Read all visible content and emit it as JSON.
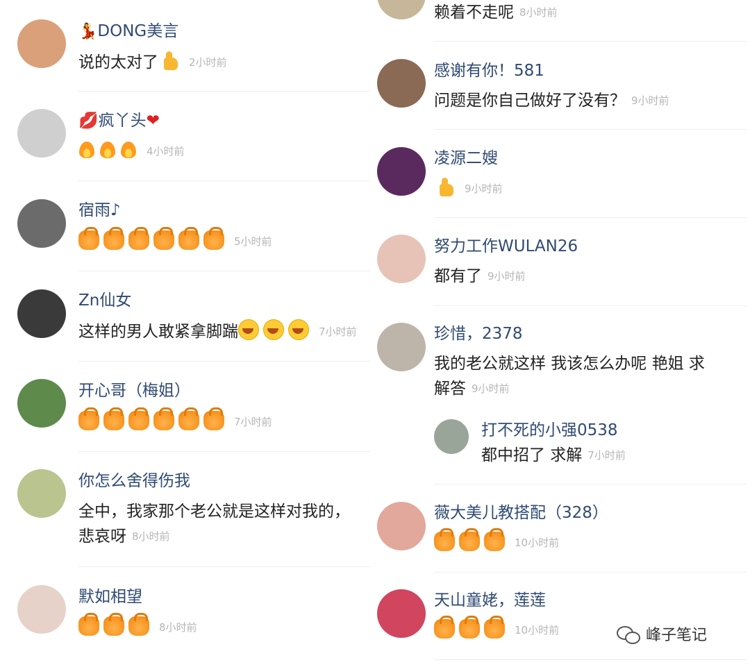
{
  "left_comments": [
    {
      "name": "DONG美言",
      "name_prefix_icon": "dancer-icon",
      "text": "说的太对了",
      "emojis": [
        "thumb"
      ],
      "time": "2小时前",
      "avatar_color": "#d9a07a"
    },
    {
      "name": "疯丫头",
      "name_prefix_icon": "lips-icon",
      "name_suffix_icon": "heart-icon",
      "text": "",
      "emojis": [
        "fire",
        "fire",
        "fire"
      ],
      "time": "4小时前",
      "avatar_color": "#9a9a9a"
    },
    {
      "name": "宿雨♪",
      "text": "",
      "emojis": [
        "bag",
        "bag",
        "bag",
        "bag",
        "bag",
        "bag"
      ],
      "time": "5小时前",
      "avatar_color": "#6b6b6b"
    },
    {
      "name": "Zn仙女",
      "text": "这样的男人敢紧拿脚踹",
      "emojis": [
        "laugh",
        "laugh",
        "laugh"
      ],
      "time": "7小时前",
      "avatar_color": "#3a3a3a"
    },
    {
      "name": "开心哥（梅姐）",
      "text": "",
      "emojis": [
        "bag",
        "bag",
        "bag",
        "bag",
        "bag",
        "bag"
      ],
      "time": "7小时前",
      "avatar_color": "#5e8a4c"
    },
    {
      "name": "你怎么舍得伤我",
      "text": "全中，我家那个老公就是这样对我的，",
      "text2": "悲哀呀",
      "emojis": [],
      "time": "8小时前",
      "avatar_color": "#b9c48f"
    },
    {
      "name": "默如相望",
      "text": "",
      "emojis": [
        "bag",
        "bag",
        "bag"
      ],
      "time": "8小时前",
      "avatar_color": "#e7d2c9"
    }
  ],
  "right_comments": [
    {
      "name": "",
      "text": "赖着不走呢",
      "emojis": [],
      "time": "8小时前",
      "avatar_color": "#c7b79a"
    },
    {
      "name": "感谢有你！581",
      "text": "问题是你自己做好了没有？",
      "emojis": [],
      "time": "9小时前",
      "avatar_color": "#8a6a55"
    },
    {
      "name": "凌源二嫂",
      "text": "",
      "emojis": [
        "thumb"
      ],
      "time": "9小时前",
      "avatar_color": "#5a2a5f"
    },
    {
      "name": "努力工作WULAN26",
      "text": "都有了",
      "emojis": [],
      "time": "9小时前",
      "avatar_color": "#e6c3b6"
    },
    {
      "name": "珍惜，2378",
      "text": "我的老公就这样 我该怎么办呢 艳姐 求",
      "text2": "解答",
      "emojis": [],
      "time": "9小时前",
      "avatar_color": "#bdb5aa"
    },
    {
      "name": "打不死的小强0538",
      "text": "都中招了 求解",
      "emojis": [],
      "time": "7小时前",
      "avatar_color": "#9aa59a",
      "reply": true
    },
    {
      "name": "薇大美儿教搭配（328）",
      "text": "",
      "emojis": [
        "bag",
        "bag",
        "bag"
      ],
      "time": "10小时前",
      "avatar_color": "#e2a89b"
    },
    {
      "name": "天山童姥，莲莲",
      "text": "",
      "emojis": [
        "bag",
        "bag",
        "bag"
      ],
      "time": "10小时前",
      "avatar_color": "#d1455f"
    }
  ],
  "watermark": {
    "text": "峰子笔记",
    "icon": "wechat-icon"
  }
}
